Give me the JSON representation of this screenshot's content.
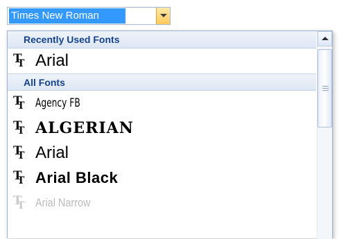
{
  "font_combo": {
    "value": "Times New Roman",
    "dropdown_icon": "chevron-down-icon"
  },
  "dropdown": {
    "recent_header": "Recently Used Fonts",
    "recent_items": [
      {
        "label": "Arial",
        "icon": "truetype-font-icon"
      }
    ],
    "all_header": "All Fonts",
    "all_items": [
      {
        "label": "Agency FB",
        "icon": "truetype-font-icon"
      },
      {
        "label": "ALGERIAN",
        "icon": "truetype-font-icon"
      },
      {
        "label": "Arial",
        "icon": "truetype-font-icon"
      },
      {
        "label": "Arial Black",
        "icon": "truetype-font-icon"
      },
      {
        "label": "Arial Narrow",
        "icon": "truetype-font-icon"
      }
    ]
  },
  "scrollbar": {
    "up_icon": "scroll-up-arrow-icon",
    "thumb_icon": "scroll-grip-icon"
  },
  "colors": {
    "selection": "#3399ff",
    "header_text": "#15428b",
    "dropdown_button": "#ffc95a"
  }
}
